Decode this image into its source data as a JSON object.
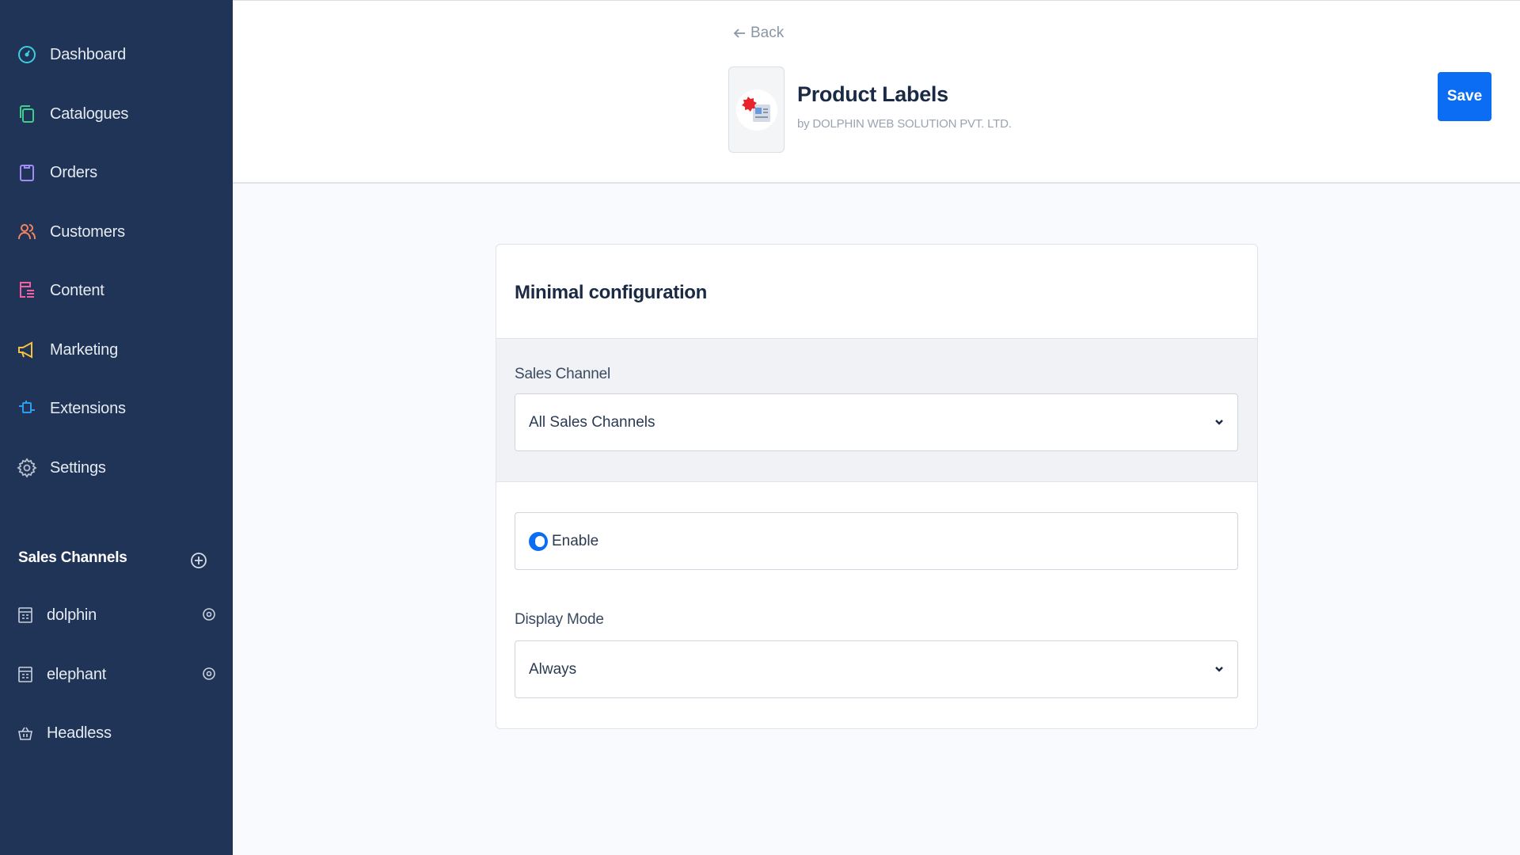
{
  "sidebar": {
    "nav": [
      {
        "label": "Dashboard",
        "icon": "dashboard-gauge-icon",
        "color": "#3ecde0"
      },
      {
        "label": "Catalogues",
        "icon": "catalogue-copy-icon",
        "color": "#3ccf8e"
      },
      {
        "label": "Orders",
        "icon": "orders-bag-icon",
        "color": "#9f8cf7"
      },
      {
        "label": "Customers",
        "icon": "customers-users-icon",
        "color": "#f4845f"
      },
      {
        "label": "Content",
        "icon": "content-list-icon",
        "color": "#f35fa0"
      },
      {
        "label": "Marketing",
        "icon": "marketing-megaphone-icon",
        "color": "#f6c23e"
      },
      {
        "label": "Extensions",
        "icon": "extensions-plugin-icon",
        "color": "#2f9bf5"
      },
      {
        "label": "Settings",
        "icon": "settings-gear-icon",
        "color": "#b6bfcc"
      }
    ],
    "sales_channels_title": "Sales Channels",
    "channels": [
      {
        "label": "dolphin",
        "icon": "storefront-icon"
      },
      {
        "label": "elephant",
        "icon": "storefront-icon"
      },
      {
        "label": "Headless",
        "icon": "basket-icon"
      }
    ]
  },
  "header": {
    "back_label": "Back",
    "app_title": "Product Labels",
    "app_vendor": "by DOLPHIN WEB SOLUTION PVT. LTD.",
    "save_label": "Save",
    "accent": "#0b6cf4"
  },
  "card": {
    "title": "Minimal configuration",
    "sales_channel_label": "Sales Channel",
    "sales_channel_value": "All Sales Channels",
    "enable_label": "Enable",
    "enable_on": true,
    "display_mode_label": "Display Mode",
    "display_mode_value": "Always"
  }
}
